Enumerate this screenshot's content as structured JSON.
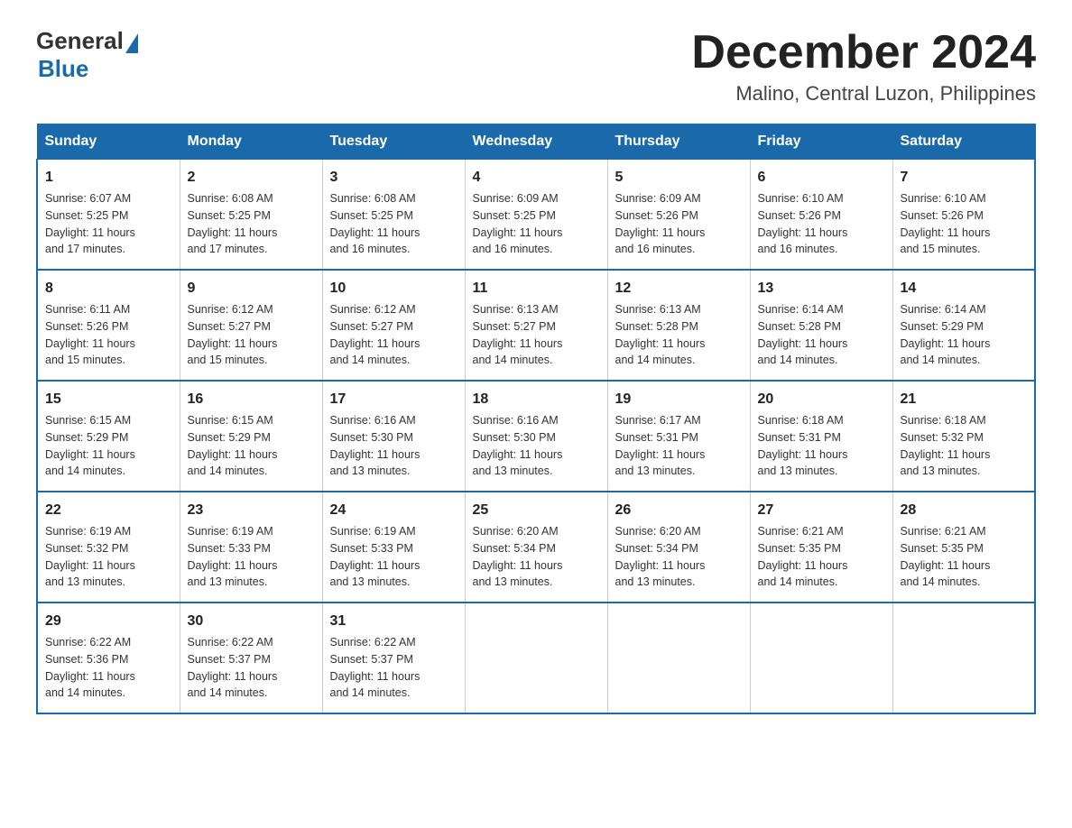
{
  "logo": {
    "general": "General",
    "blue": "Blue"
  },
  "title": "December 2024",
  "subtitle": "Malino, Central Luzon, Philippines",
  "days_of_week": [
    "Sunday",
    "Monday",
    "Tuesday",
    "Wednesday",
    "Thursday",
    "Friday",
    "Saturday"
  ],
  "weeks": [
    [
      {
        "date": "1",
        "sunrise": "6:07 AM",
        "sunset": "5:25 PM",
        "daylight": "11 hours and 17 minutes."
      },
      {
        "date": "2",
        "sunrise": "6:08 AM",
        "sunset": "5:25 PM",
        "daylight": "11 hours and 17 minutes."
      },
      {
        "date": "3",
        "sunrise": "6:08 AM",
        "sunset": "5:25 PM",
        "daylight": "11 hours and 16 minutes."
      },
      {
        "date": "4",
        "sunrise": "6:09 AM",
        "sunset": "5:25 PM",
        "daylight": "11 hours and 16 minutes."
      },
      {
        "date": "5",
        "sunrise": "6:09 AM",
        "sunset": "5:26 PM",
        "daylight": "11 hours and 16 minutes."
      },
      {
        "date": "6",
        "sunrise": "6:10 AM",
        "sunset": "5:26 PM",
        "daylight": "11 hours and 16 minutes."
      },
      {
        "date": "7",
        "sunrise": "6:10 AM",
        "sunset": "5:26 PM",
        "daylight": "11 hours and 15 minutes."
      }
    ],
    [
      {
        "date": "8",
        "sunrise": "6:11 AM",
        "sunset": "5:26 PM",
        "daylight": "11 hours and 15 minutes."
      },
      {
        "date": "9",
        "sunrise": "6:12 AM",
        "sunset": "5:27 PM",
        "daylight": "11 hours and 15 minutes."
      },
      {
        "date": "10",
        "sunrise": "6:12 AM",
        "sunset": "5:27 PM",
        "daylight": "11 hours and 14 minutes."
      },
      {
        "date": "11",
        "sunrise": "6:13 AM",
        "sunset": "5:27 PM",
        "daylight": "11 hours and 14 minutes."
      },
      {
        "date": "12",
        "sunrise": "6:13 AM",
        "sunset": "5:28 PM",
        "daylight": "11 hours and 14 minutes."
      },
      {
        "date": "13",
        "sunrise": "6:14 AM",
        "sunset": "5:28 PM",
        "daylight": "11 hours and 14 minutes."
      },
      {
        "date": "14",
        "sunrise": "6:14 AM",
        "sunset": "5:29 PM",
        "daylight": "11 hours and 14 minutes."
      }
    ],
    [
      {
        "date": "15",
        "sunrise": "6:15 AM",
        "sunset": "5:29 PM",
        "daylight": "11 hours and 14 minutes."
      },
      {
        "date": "16",
        "sunrise": "6:15 AM",
        "sunset": "5:29 PM",
        "daylight": "11 hours and 14 minutes."
      },
      {
        "date": "17",
        "sunrise": "6:16 AM",
        "sunset": "5:30 PM",
        "daylight": "11 hours and 13 minutes."
      },
      {
        "date": "18",
        "sunrise": "6:16 AM",
        "sunset": "5:30 PM",
        "daylight": "11 hours and 13 minutes."
      },
      {
        "date": "19",
        "sunrise": "6:17 AM",
        "sunset": "5:31 PM",
        "daylight": "11 hours and 13 minutes."
      },
      {
        "date": "20",
        "sunrise": "6:18 AM",
        "sunset": "5:31 PM",
        "daylight": "11 hours and 13 minutes."
      },
      {
        "date": "21",
        "sunrise": "6:18 AM",
        "sunset": "5:32 PM",
        "daylight": "11 hours and 13 minutes."
      }
    ],
    [
      {
        "date": "22",
        "sunrise": "6:19 AM",
        "sunset": "5:32 PM",
        "daylight": "11 hours and 13 minutes."
      },
      {
        "date": "23",
        "sunrise": "6:19 AM",
        "sunset": "5:33 PM",
        "daylight": "11 hours and 13 minutes."
      },
      {
        "date": "24",
        "sunrise": "6:19 AM",
        "sunset": "5:33 PM",
        "daylight": "11 hours and 13 minutes."
      },
      {
        "date": "25",
        "sunrise": "6:20 AM",
        "sunset": "5:34 PM",
        "daylight": "11 hours and 13 minutes."
      },
      {
        "date": "26",
        "sunrise": "6:20 AM",
        "sunset": "5:34 PM",
        "daylight": "11 hours and 13 minutes."
      },
      {
        "date": "27",
        "sunrise": "6:21 AM",
        "sunset": "5:35 PM",
        "daylight": "11 hours and 14 minutes."
      },
      {
        "date": "28",
        "sunrise": "6:21 AM",
        "sunset": "5:35 PM",
        "daylight": "11 hours and 14 minutes."
      }
    ],
    [
      {
        "date": "29",
        "sunrise": "6:22 AM",
        "sunset": "5:36 PM",
        "daylight": "11 hours and 14 minutes."
      },
      {
        "date": "30",
        "sunrise": "6:22 AM",
        "sunset": "5:37 PM",
        "daylight": "11 hours and 14 minutes."
      },
      {
        "date": "31",
        "sunrise": "6:22 AM",
        "sunset": "5:37 PM",
        "daylight": "11 hours and 14 minutes."
      },
      null,
      null,
      null,
      null
    ]
  ],
  "labels": {
    "sunrise": "Sunrise:",
    "sunset": "Sunset:",
    "daylight": "Daylight:"
  }
}
